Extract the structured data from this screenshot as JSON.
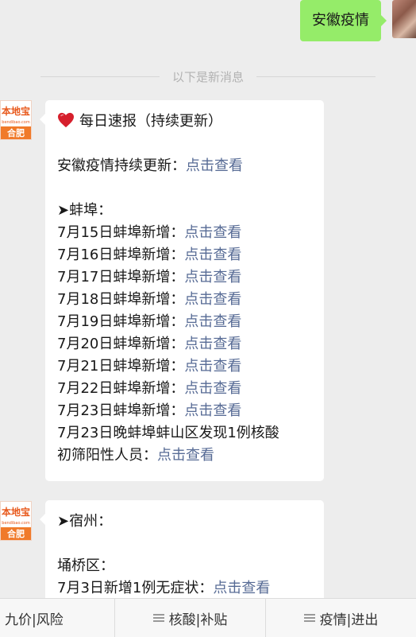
{
  "sent_message": "安徽疫情",
  "divider_text": "以下是新消息",
  "avatar": {
    "brand": "本地宝",
    "url_text": "bendibao.com",
    "city": "合肥"
  },
  "message1": {
    "title": "每日速报（持续更新）",
    "anhui_line": {
      "text": "安徽疫情持续更新：",
      "link": "点击查看"
    },
    "section_bengbu": "➤蚌埠：",
    "bengbu_lines": [
      {
        "text": "7月15日蚌埠新增：",
        "link": "点击查看"
      },
      {
        "text": "7月16日蚌埠新增：",
        "link": "点击查看"
      },
      {
        "text": "7月17日蚌埠新增：",
        "link": "点击查看"
      },
      {
        "text": "7月18日蚌埠新增：",
        "link": "点击查看"
      },
      {
        "text": "7月19日蚌埠新增：",
        "link": "点击查看"
      },
      {
        "text": "7月20日蚌埠新增：",
        "link": "点击查看"
      },
      {
        "text": "7月21日蚌埠新增：",
        "link": "点击查看"
      },
      {
        "text": "7月22日蚌埠新增：",
        "link": "点击查看"
      },
      {
        "text": "7月23日蚌埠新增：",
        "link": "点击查看"
      }
    ],
    "long_line_1": "7月23日晚蚌埠蚌山区发现1例核酸",
    "long_line_2": "初筛阳性人员：",
    "long_link": "点击查看"
  },
  "message2": {
    "section_suzhou": "➤宿州：",
    "district": "埇桥区：",
    "line": {
      "text": "7月3日新增1例无症状：",
      "link": "点击查看"
    }
  },
  "bottom_menu": [
    "九价|风险",
    "核酸|补贴",
    "疫情|进出"
  ]
}
